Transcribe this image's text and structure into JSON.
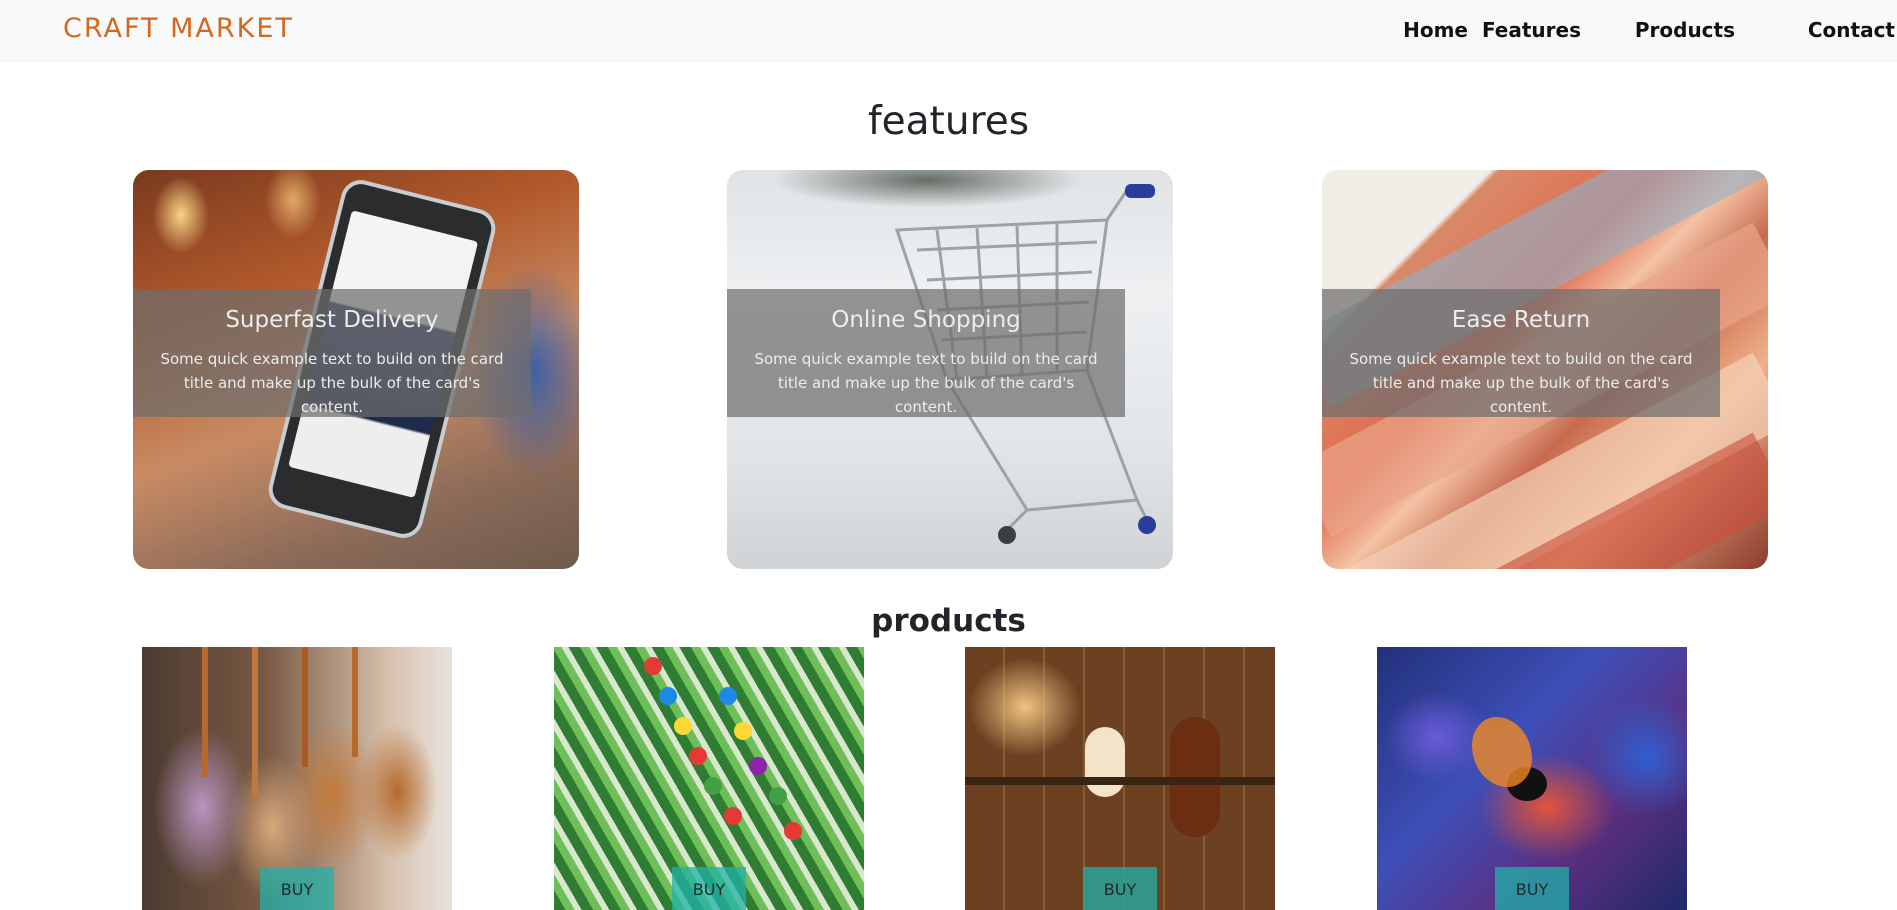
{
  "navbar": {
    "brand": "CRAFT MARKET",
    "links": [
      "Home",
      "Features",
      "Products",
      "Contact"
    ]
  },
  "features": {
    "title": "features",
    "cards": [
      {
        "title": "Superfast Delivery",
        "text": "Some quick example text to build on the card title and make up the bulk of the card's content.",
        "image": "phone-shopping-photo"
      },
      {
        "title": "Online Shopping",
        "text": "Some quick example text to build on the card title and make up the bulk of the card's content.",
        "image": "shopping-cart-snow-photo"
      },
      {
        "title": "Ease Return",
        "text": "Some quick example text to build on the card title and make up the bulk of the card's content.",
        "image": "euro-banknotes-photo"
      }
    ]
  },
  "products": {
    "title": "products",
    "items": [
      {
        "image": "woven-bags-photo",
        "button": "BUY"
      },
      {
        "image": "beaded-necklace-photo",
        "button": "BUY"
      },
      {
        "image": "workshop-tools-photo",
        "button": "BUY"
      },
      {
        "image": "alebrije-figures-photo",
        "button": "BUY"
      }
    ]
  },
  "colors": {
    "brand": "#d2691e",
    "navbar_bg": "#f8f9fa",
    "buy_button": "#20b2aa",
    "overlay": "#6e6e6e"
  }
}
